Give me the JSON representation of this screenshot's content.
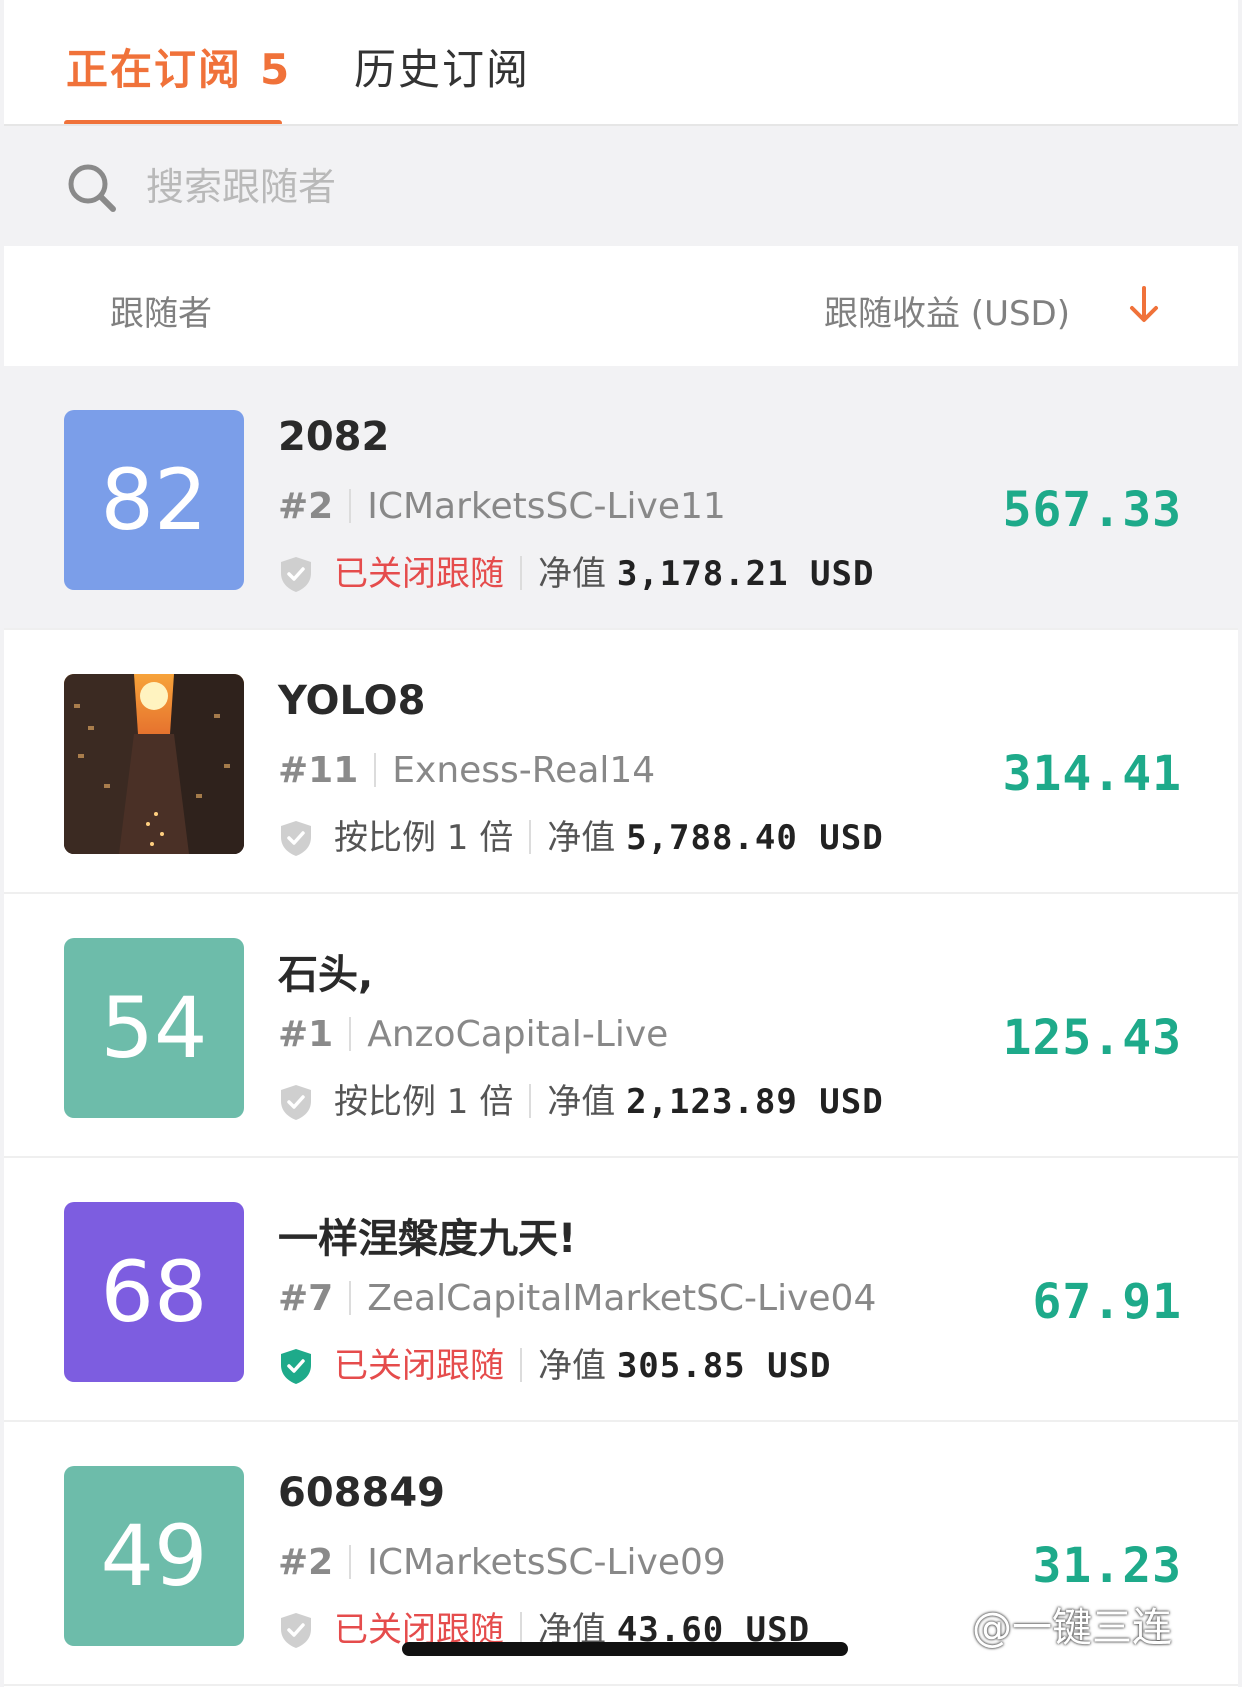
{
  "tabs": {
    "active_label": "正在订阅",
    "active_count": "5",
    "history_label": "历史订阅"
  },
  "search": {
    "placeholder": "搜索跟随者"
  },
  "columns": {
    "follower": "跟随者",
    "profit": "跟随收益 (USD)"
  },
  "rows": [
    {
      "avatar_text": "82",
      "avatar_color": "#7b9ee9",
      "name": "2082",
      "rank": "#2",
      "server": "ICMarketsSC-Live11",
      "status": "已关闭跟随",
      "status_type": "closed",
      "shield": "grey",
      "equity_label": "净值",
      "equity_value": "3,178.21 USD",
      "profit": "567.33"
    },
    {
      "avatar_text": "",
      "avatar_color": "#3a2a22",
      "name": "YOLO8",
      "rank": "#11",
      "server": "Exness-Real14",
      "status": "按比例 1 倍",
      "status_type": "ratio",
      "shield": "grey",
      "equity_label": "净值",
      "equity_value": "5,788.40 USD",
      "profit": "314.41"
    },
    {
      "avatar_text": "54",
      "avatar_color": "#6dbcaa",
      "name": "石头,",
      "rank": "#1",
      "server": "AnzoCapital-Live",
      "status": "按比例 1 倍",
      "status_type": "ratio",
      "shield": "grey",
      "equity_label": "净值",
      "equity_value": "2,123.89 USD",
      "profit": "125.43"
    },
    {
      "avatar_text": "68",
      "avatar_color": "#7d5de0",
      "name": "一样涅槃度九天!",
      "rank": "#7",
      "server": "ZealCapitalMarketSC-Live04",
      "status": "已关闭跟随",
      "status_type": "closed",
      "shield": "green",
      "equity_label": "净值",
      "equity_value": "305.85 USD",
      "profit": "67.91"
    },
    {
      "avatar_text": "49",
      "avatar_color": "#6dbcaa",
      "name": "608849",
      "rank": "#2",
      "server": "ICMarketsSC-Live09",
      "status": "已关闭跟随",
      "status_type": "closed",
      "shield": "grey",
      "equity_label": "净值",
      "equity_value": "43.60 USD",
      "profit": "31.23"
    }
  ],
  "watermark": "@一键三连",
  "colors": {
    "accent": "#f0723a",
    "profit": "#1eaa8a",
    "closed": "#e54c4c"
  }
}
